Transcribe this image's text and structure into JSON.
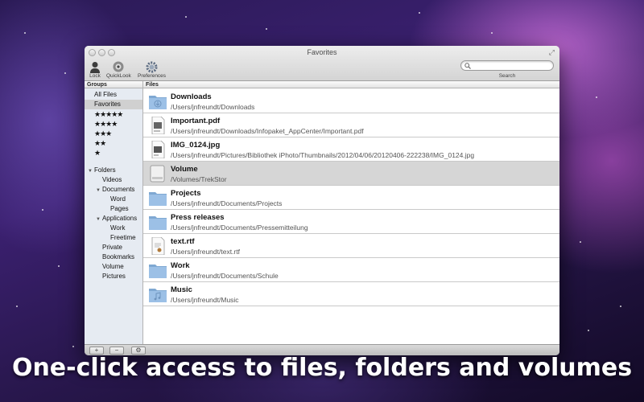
{
  "window": {
    "title": "Favorites"
  },
  "toolbar": {
    "lock": "Lock",
    "quicklook": "QuickLook",
    "preferences": "Preferences",
    "search_label": "Search",
    "search_value": ""
  },
  "sidebar": {
    "header": "Groups",
    "items": [
      "All Files",
      "Favorites",
      "★★★★★",
      "★★★★",
      "★★★",
      "★★",
      "★"
    ],
    "tree": [
      {
        "label": "Folders",
        "level": 0,
        "expanded": true
      },
      {
        "label": "Videos",
        "level": 1
      },
      {
        "label": "Documents",
        "level": 1,
        "expanded": true
      },
      {
        "label": "Word",
        "level": 2
      },
      {
        "label": "Pages",
        "level": 2
      },
      {
        "label": "Applications",
        "level": 1,
        "expanded": true
      },
      {
        "label": "Work",
        "level": 2
      },
      {
        "label": "Freetime",
        "level": 2
      },
      {
        "label": "Private",
        "level": 1
      },
      {
        "label": "Bookmarks",
        "level": 1
      },
      {
        "label": "Volume",
        "level": 1
      },
      {
        "label": "Pictures",
        "level": 1
      }
    ]
  },
  "files": {
    "header": "Files",
    "rows": [
      {
        "name": "Downloads",
        "path": "/Users/jnfreundt/Downloads",
        "icon": "downloads-folder-icon"
      },
      {
        "name": "Important.pdf",
        "path": "/Users/jnfreundt/Downloads/Infopaket_AppCenter/Important.pdf",
        "icon": "pdf-file-icon"
      },
      {
        "name": "IMG_0124.jpg",
        "path": "/Users/jnfreundt/Pictures/Bibliothek iPhoto/Thumbnails/2012/04/06/20120406-222238/IMG_0124.jpg",
        "icon": "jpg-file-icon"
      },
      {
        "name": "Volume",
        "path": "/Volumes/TrekStor",
        "icon": "drive-icon",
        "selected": true
      },
      {
        "name": "Projects",
        "path": "/Users/jnfreundt/Documents/Projects",
        "icon": "folder-icon"
      },
      {
        "name": "Press releases",
        "path": "/Users/jnfreundt/Documents/Pressemitteilung",
        "icon": "folder-icon"
      },
      {
        "name": "text.rtf",
        "path": "/Users/jnfreundt/text.rtf",
        "icon": "rtf-file-icon"
      },
      {
        "name": "Work",
        "path": "/Users/jnfreundt/Documents/Schule",
        "icon": "folder-icon"
      },
      {
        "name": "Music",
        "path": "/Users/jnfreundt/Music",
        "icon": "music-folder-icon"
      }
    ]
  },
  "bottombar": {
    "add": "+",
    "remove": "−",
    "action": "⚙"
  },
  "caption": "One-click access to files, folders and volumes"
}
